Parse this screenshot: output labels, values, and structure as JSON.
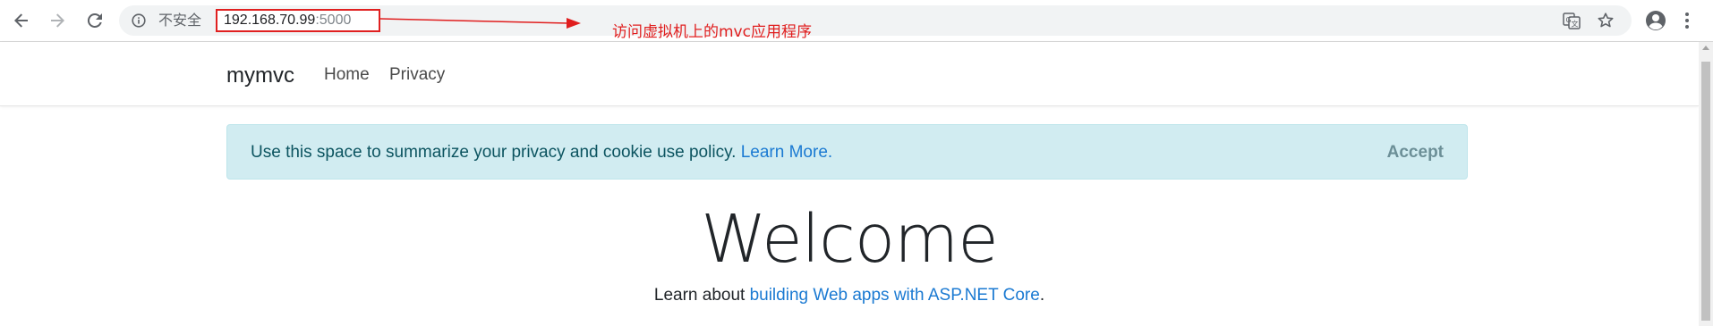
{
  "browser": {
    "security_label": "不安全",
    "url_host": "192.168.70.99",
    "url_port": ":5000",
    "icons": [
      "back-icon",
      "forward-icon",
      "reload-icon",
      "info-icon",
      "translate-icon",
      "bookmark-star-icon",
      "profile-icon",
      "menu-icon"
    ]
  },
  "annotation": {
    "text": "访问虚拟机上的mvc应用程序",
    "color": "#e01e1e"
  },
  "navbar": {
    "brand": "mymvc",
    "links": [
      "Home",
      "Privacy"
    ]
  },
  "cookie": {
    "message": "Use this space to summarize your privacy and cookie use policy.",
    "link": "Learn More.",
    "accept": "Accept"
  },
  "main": {
    "heading": "Welcome",
    "learn_prefix": "Learn about",
    "learn_link": "building Web apps with ASP.NET Core",
    "learn_suffix": "."
  },
  "colors": {
    "alert_bg": "#d1ecf1",
    "link": "#1b7ad2",
    "annotation_red": "#e01e1e"
  }
}
